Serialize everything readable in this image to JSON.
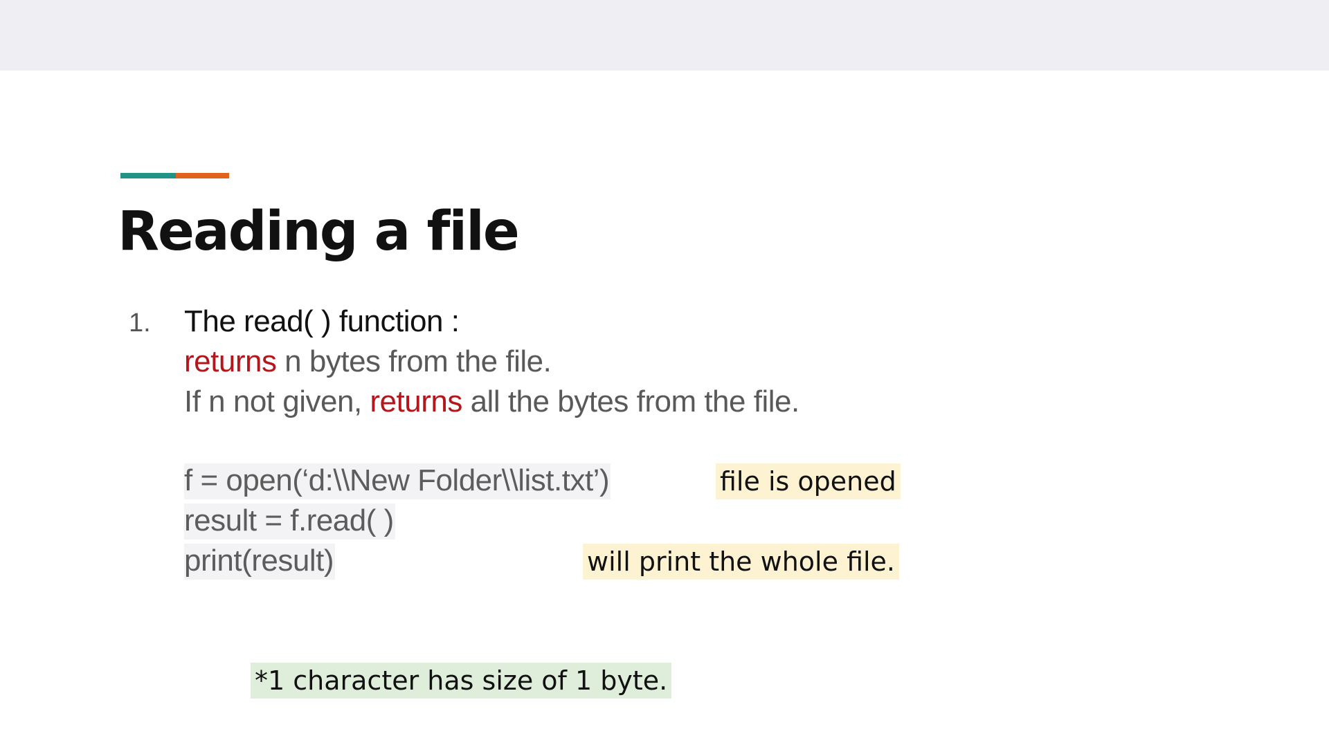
{
  "colors": {
    "top_band": "#efeff3",
    "accent_teal": "#1f9486",
    "accent_orange": "#e0641c",
    "keyword_red": "#b3161b",
    "note_yellow": "#fdf2d2",
    "note_green": "#dfeedb"
  },
  "slide": {
    "title": "Reading a file",
    "list_number": "1.",
    "heading_line": "The read( ) function :",
    "line2": {
      "keyword": "returns",
      "rest": " n bytes from the file."
    },
    "line3": {
      "before": "If n not given, ",
      "keyword": "returns",
      "after": " all the bytes from the file."
    },
    "code": [
      "f = open(‘d:\\\\New Folder\\\\list.txt’)",
      "result = f.read( )",
      "print(result)"
    ],
    "notes": {
      "opened": "file is opened",
      "print_whole": "will print the whole file.",
      "char_size": "*1 character has size of 1 byte."
    }
  }
}
